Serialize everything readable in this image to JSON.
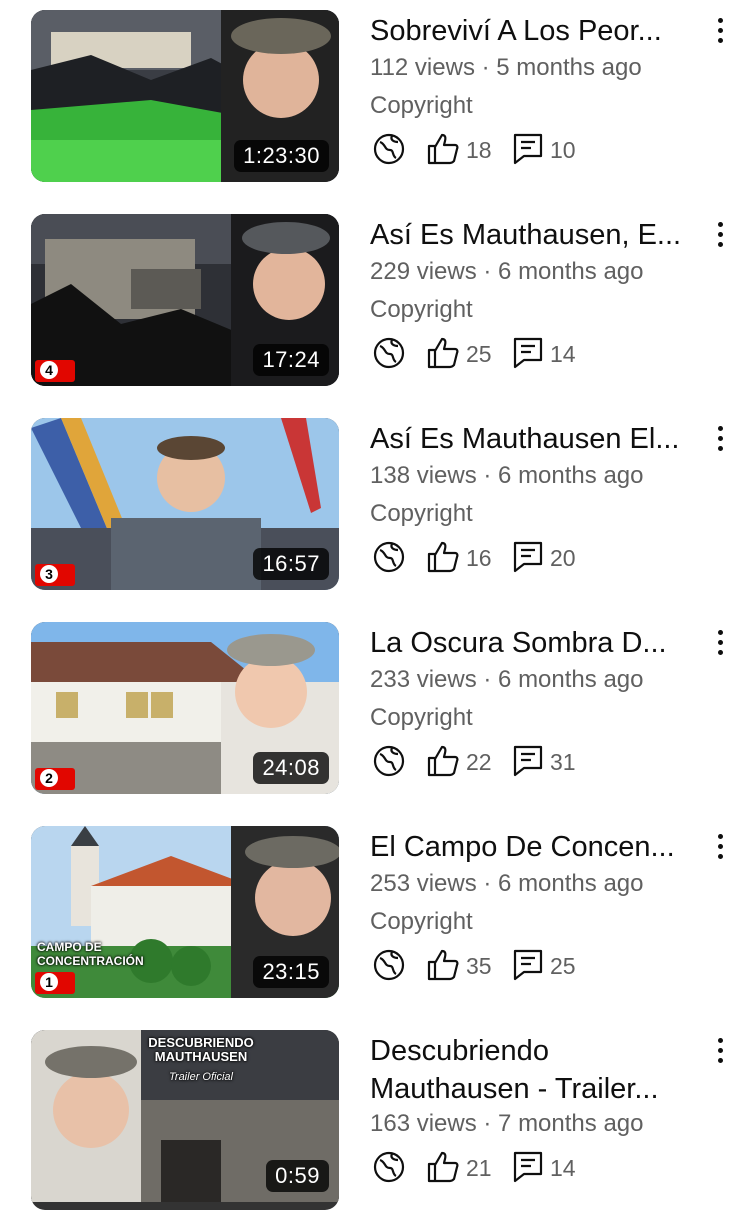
{
  "videos": [
    {
      "title": "Sobreviví A Los Peor...",
      "meta": "112 views · 5 months ago",
      "label": "Copyright",
      "duration": "1:23:30",
      "likes": "18",
      "comments": "10",
      "part_badge": ""
    },
    {
      "title": "Así Es Mauthausen, E...",
      "meta": "229 views · 6 months ago",
      "label": "Copyright",
      "duration": "17:24",
      "likes": "25",
      "comments": "14",
      "part_badge": "4"
    },
    {
      "title": "Así Es Mauthausen El...",
      "meta": "138 views · 6 months ago",
      "label": "Copyright",
      "duration": "16:57",
      "likes": "16",
      "comments": "20",
      "part_badge": "3"
    },
    {
      "title": "La Oscura Sombra D...",
      "meta": "233 views · 6 months ago",
      "label": "Copyright",
      "duration": "24:08",
      "likes": "22",
      "comments": "31",
      "part_badge": "2"
    },
    {
      "title": "El Campo De Concen...",
      "meta": "253 views · 6 months ago",
      "label": "Copyright",
      "duration": "23:15",
      "likes": "35",
      "comments": "25",
      "part_badge": "1",
      "thumb_text": "CAMPO DE CONCENTRACIÓN"
    },
    {
      "title": "Descubriendo Mauthausen - Trailer...",
      "meta": "163 views · 7 months ago",
      "label": "",
      "duration": "0:59",
      "likes": "21",
      "comments": "14",
      "part_badge": "",
      "thumb_text": "DESCUBRIENDO MAUTHAUSEN",
      "thumb_subtext": "Trailer Oficial"
    }
  ],
  "icons": {
    "visibility": "globe-icon",
    "likes": "thumbs-up-icon",
    "comments": "comment-icon",
    "menu": "more-vert-icon"
  }
}
